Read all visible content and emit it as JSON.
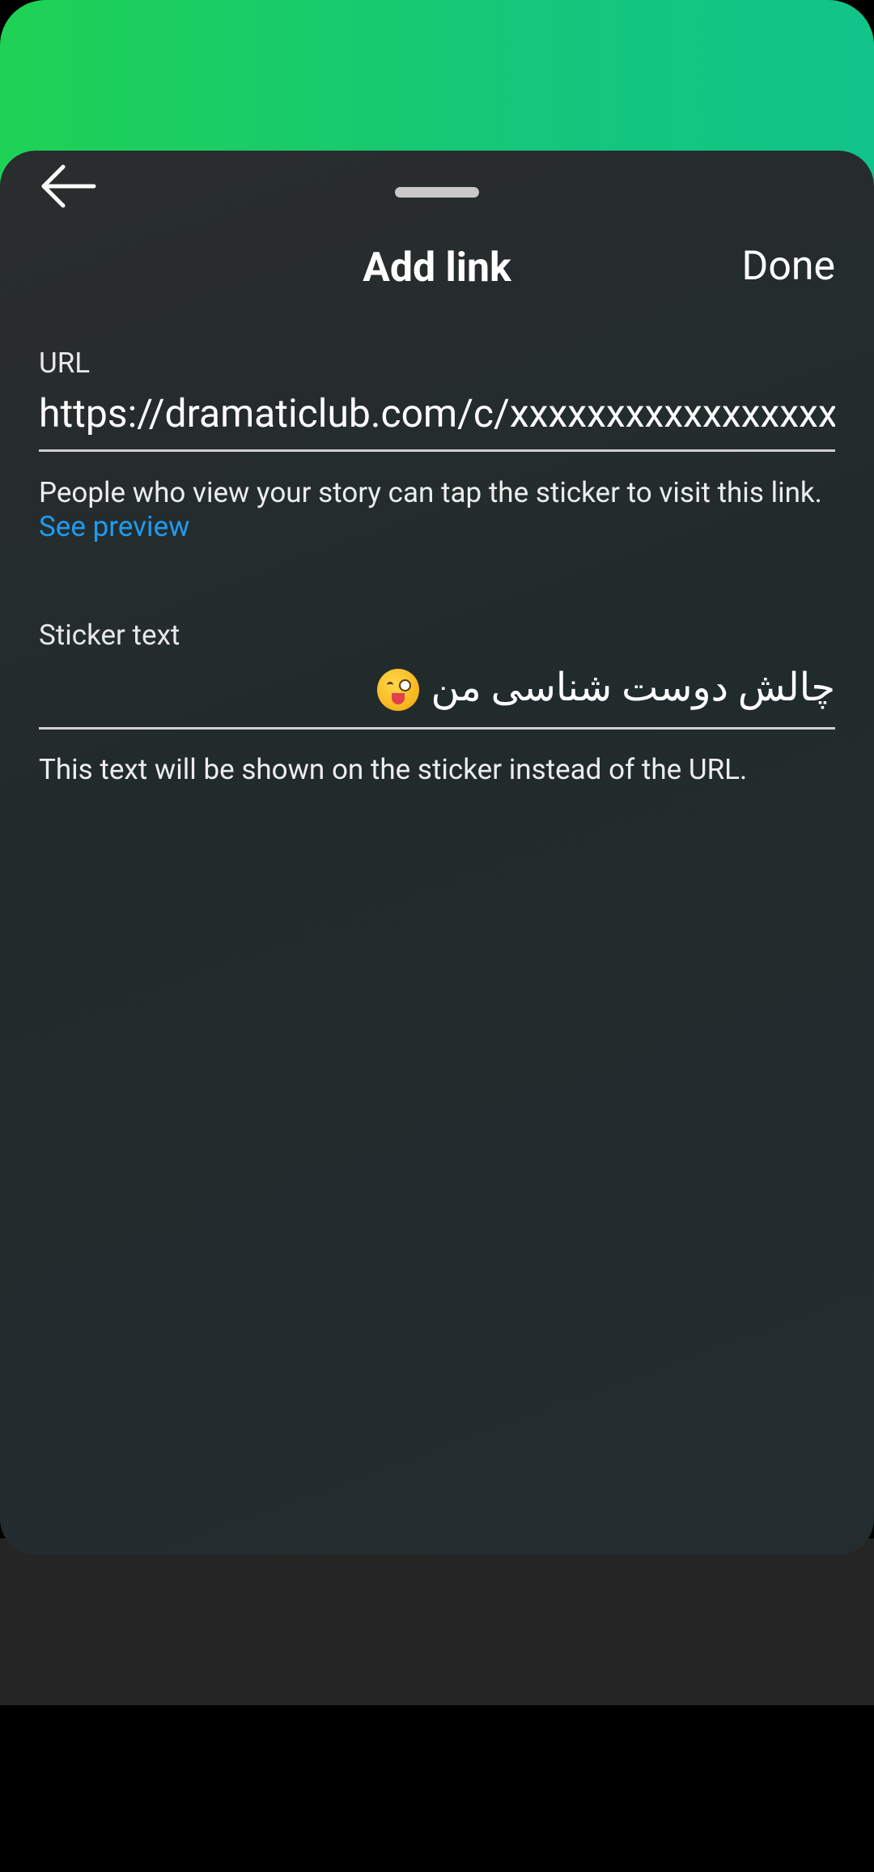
{
  "header": {
    "back_icon": "arrow-left-icon",
    "title": "Add link",
    "done_label": "Done"
  },
  "url_field": {
    "label": "URL",
    "value": "https://dramaticlub.com/c/xxxxxxxxxxxxxxxxxx",
    "helper_text": "People who view your story can tap the sticker to visit this link.",
    "helper_link": "See preview"
  },
  "sticker_field": {
    "label": "Sticker text",
    "value": "چالش دوست شناسی من",
    "emoji": "winking-face-with-tongue",
    "helper_text": "This text will be shown on the sticker instead of the URL."
  },
  "colors": {
    "accent_link": "#1e9bf0",
    "gradient_start": "#1fd255",
    "gradient_end": "#12c48a",
    "sheet_bg": "#242b2c"
  }
}
